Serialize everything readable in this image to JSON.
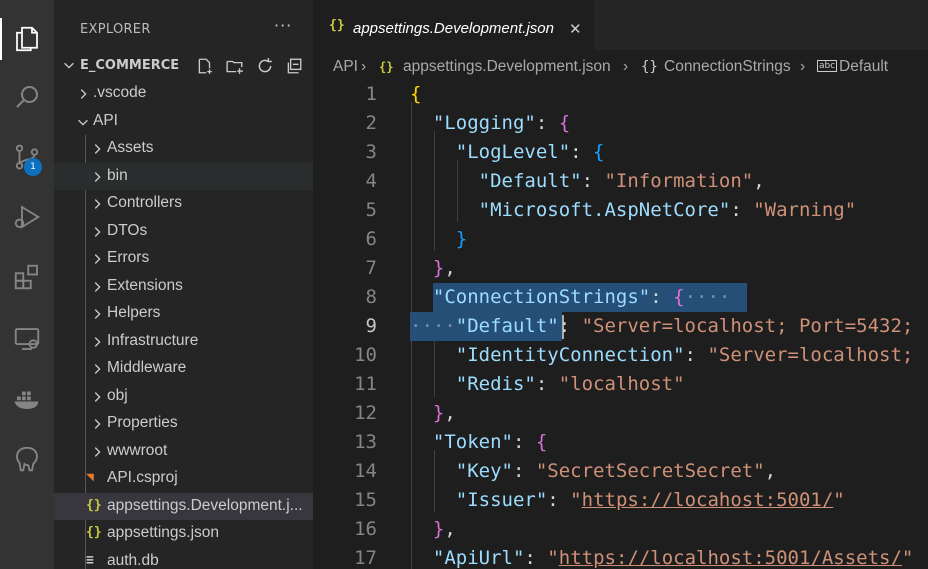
{
  "explorer": {
    "title": "EXPLORER",
    "more": "···",
    "section": "E_COMMERCE",
    "items": [
      {
        "label": ".vscode",
        "type": "folder"
      },
      {
        "label": "API",
        "type": "folder-open"
      },
      {
        "label": "Assets",
        "type": "folder"
      },
      {
        "label": "bin",
        "type": "folder"
      },
      {
        "label": "Controllers",
        "type": "folder"
      },
      {
        "label": "DTOs",
        "type": "folder"
      },
      {
        "label": "Errors",
        "type": "folder"
      },
      {
        "label": "Extensions",
        "type": "folder"
      },
      {
        "label": "Helpers",
        "type": "folder"
      },
      {
        "label": "Infrastructure",
        "type": "folder"
      },
      {
        "label": "Middleware",
        "type": "folder"
      },
      {
        "label": "obj",
        "type": "folder"
      },
      {
        "label": "Properties",
        "type": "folder"
      },
      {
        "label": "wwwroot",
        "type": "folder"
      },
      {
        "label": "API.csproj",
        "type": "rss-icon"
      },
      {
        "label": "appsettings.Development.j...",
        "type": "json-icon"
      },
      {
        "label": "appsettings.json",
        "type": "json-icon"
      },
      {
        "label": "auth.db",
        "type": "lines-icon"
      }
    ]
  },
  "activity": {
    "source_control_badge": "1"
  },
  "tab": {
    "icon": "{}",
    "label": "appsettings.Development.json",
    "close": "✕"
  },
  "breadcrumb": {
    "parts": [
      "API",
      "appsettings.Development.json",
      "ConnectionStrings",
      "Default"
    ],
    "sep": "›",
    "obj_icon": "{}",
    "str_icon": "abc"
  },
  "code": {
    "line_numbers": [
      "1",
      "2",
      "3",
      "4",
      "5",
      "6",
      "7",
      "8",
      "9",
      "10",
      "11",
      "12",
      "13",
      "14",
      "15",
      "16",
      "17"
    ],
    "lines": {
      "l1": [
        "{"
      ],
      "l2": [
        "\"Logging\"",
        ": ",
        "{"
      ],
      "l3": [
        "\"LogLevel\"",
        ": ",
        "{"
      ],
      "l4": [
        "\"Default\"",
        ": ",
        "\"Information\"",
        ","
      ],
      "l5": [
        "\"Microsoft.AspNetCore\"",
        ": ",
        "\"Warning\""
      ],
      "l6": [
        "}"
      ],
      "l7": [
        "}",
        ","
      ],
      "l8": [
        "\"ConnectionStrings\"",
        ": ",
        "{",
        "····"
      ],
      "l9": [
        "····",
        "\"Default\"",
        ": ",
        "\"Server=localhost; Port=5432;"
      ],
      "l10": [
        "\"IdentityConnection\"",
        ": ",
        "\"Server=localhost;"
      ],
      "l11": [
        "\"Redis\"",
        ": ",
        "\"localhost\""
      ],
      "l12": [
        "}",
        ","
      ],
      "l13": [
        "\"Token\"",
        ": ",
        "{"
      ],
      "l14": [
        "\"Key\"",
        ": ",
        "\"SecretSecretSecret\"",
        ","
      ],
      "l15": [
        "\"Issuer\"",
        ": ",
        "\"",
        "https://locahost:5001/",
        "\""
      ],
      "l16": [
        "}",
        ","
      ],
      "l17": [
        "\"ApiUrl\"",
        ": ",
        "\"",
        "https://localhost:5001/Assets/",
        "\""
      ]
    }
  },
  "colors": {
    "key": "#9cdcfe",
    "string": "#ce9178",
    "bracket_level1": "#ffd700",
    "bracket_level2": "#da70d6",
    "bracket_level3": "#179fff",
    "selection": "#264f78",
    "badge": "#0e70c0"
  }
}
